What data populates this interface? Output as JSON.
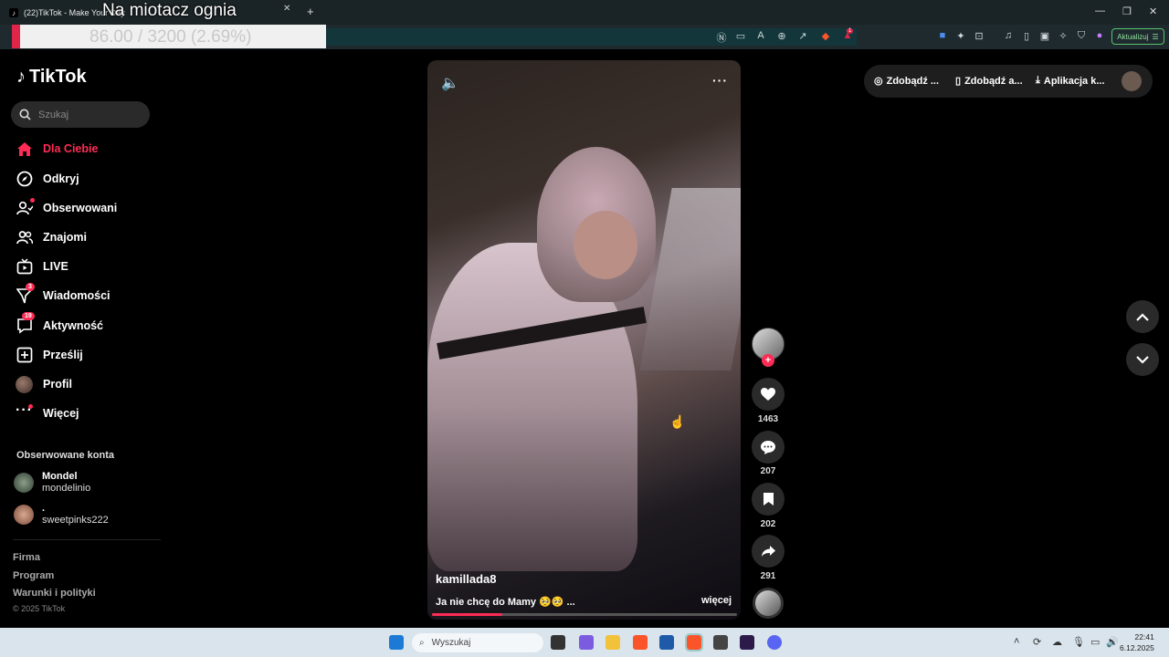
{
  "browser": {
    "tab_title": "(22)TikTok - Make Your Day",
    "overlay_title": "Na miotacz ognia",
    "overlay_progress_text": "86.00 / 3200 (2.69%)",
    "overlay_progress": 0.0269,
    "update_button": "Aktualizuj",
    "brave_badge": "1"
  },
  "sidebar": {
    "logo": "TikTok",
    "search_placeholder": "Szukaj",
    "items": [
      {
        "label": "Dla Ciebie",
        "icon": "home-icon",
        "active": true
      },
      {
        "label": "Odkryj",
        "icon": "compass-icon"
      },
      {
        "label": "Obserwowani",
        "icon": "following-icon"
      },
      {
        "label": "Znajomi",
        "icon": "friends-icon"
      },
      {
        "label": "LIVE",
        "icon": "live-icon"
      },
      {
        "label": "Wiadomości",
        "icon": "messages-icon",
        "badge": "3"
      },
      {
        "label": "Aktywność",
        "icon": "activity-icon",
        "badge": "19"
      },
      {
        "label": "Prześlij",
        "icon": "upload-icon"
      },
      {
        "label": "Profil",
        "icon": "profile-avatar"
      },
      {
        "label": "Więcej",
        "icon": "more-icon"
      }
    ],
    "followed_title": "Obserwowane konta",
    "followed": [
      {
        "name": "Mondel",
        "handle": "mondelinio"
      },
      {
        "name": ".",
        "handle": "sweetpinks222"
      }
    ],
    "footer": [
      "Firma",
      "Program",
      "Warunki i polityki"
    ],
    "copyright": "© 2025 TikTok"
  },
  "video": {
    "author": "kamillada8",
    "description": "Ja nie chcę do Mamy 🥺🥺 ...",
    "more_label": "więcej",
    "progress": 0.23
  },
  "actions": {
    "likes": "1463",
    "comments": "207",
    "saves": "202",
    "shares": "291"
  },
  "topright": {
    "item1": "Zdobądź ...",
    "item2": "Zdobądź a...",
    "item3": "Aplikacja k..."
  },
  "taskbar": {
    "search_placeholder": "Wyszukaj",
    "time": "22:41",
    "date": "6.12.2025"
  }
}
